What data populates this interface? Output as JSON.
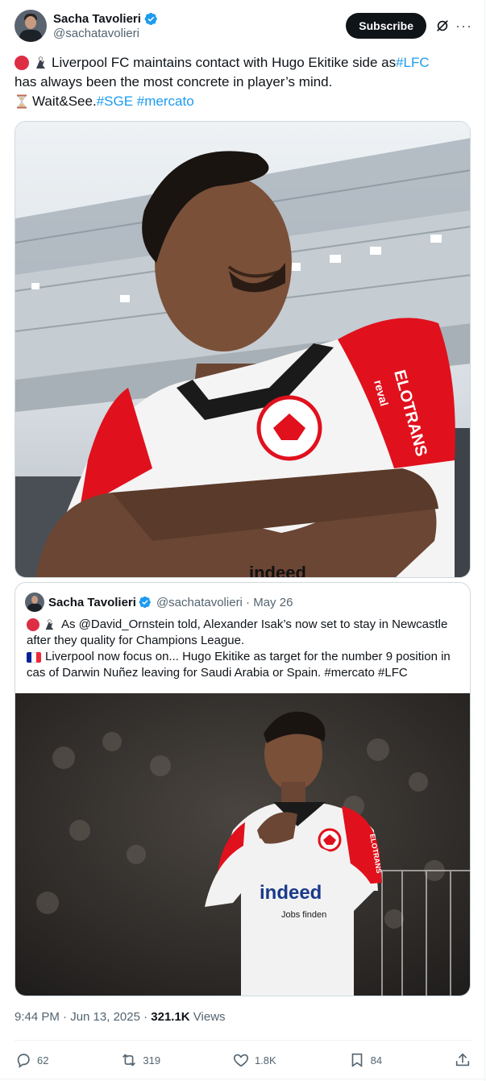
{
  "author": {
    "name": "Sacha Tavolieri",
    "handle": "@sachatavolieri"
  },
  "header": {
    "subscribe_label": "Subscribe"
  },
  "tweet": {
    "line1_text": "Liverpool FC maintains contact with Hugo Ekitike side as ",
    "line1_tag": "#LFC",
    "line2_text": "has always been the most concrete in player’s mind.",
    "line3_text": "Wait&See. ",
    "line3_tag1": "#SGE",
    "line3_tag2": "#mercato"
  },
  "photo1": {
    "shirt_sponsor": "indeed",
    "sleeve_text": "ELOTRANS",
    "sleeve_text2": "reval"
  },
  "quote": {
    "name": "Sacha Tavolieri",
    "meta": "@sachatavolieri · May 26",
    "line1": "As @David_Ornstein told, Alexander Isak’s now set to stay in Newcastle",
    "line2": "after they quality for Champions League.",
    "line3": "Liverpool now focus on... Hugo Ekitike as target for the number 9 position in",
    "line4": "cas of Darwin Nuñez leaving for Saudi Arabia or Spain. #mercato #LFC",
    "photo_sponsor": "indeed",
    "photo_sponsor_sub": "Jobs finden",
    "photo_sleeve": "ELOTRANS"
  },
  "meta": {
    "time_date": "9:44 PM · Jun 13, 2025 · ",
    "views_count": "321.1K",
    "views_label": " Views"
  },
  "actions": {
    "replies": "62",
    "reposts": "319",
    "likes": "1.8K",
    "bookmarks": "84"
  },
  "icons": {
    "verified": "verified-badge-icon",
    "grok": "grok-icon",
    "more": "more-icon",
    "reply": "reply-icon",
    "repost": "repost-icon",
    "like": "heart-icon",
    "bookmark": "bookmark-icon",
    "share": "share-icon"
  },
  "colors": {
    "accent": "#1d9bf0",
    "text": "#0f1419",
    "muted": "#536471",
    "jersey_red": "#e0111d"
  }
}
